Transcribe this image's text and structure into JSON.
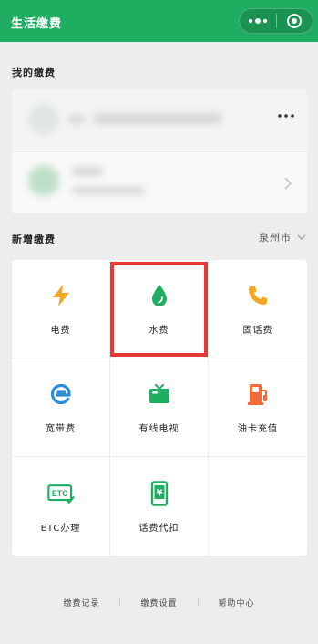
{
  "header": {
    "title": "生活缴费"
  },
  "sections": {
    "mine": "我的缴费",
    "new": "新增缴费"
  },
  "city": "泉州市",
  "services": [
    {
      "label": "电费",
      "icon": "lightning-icon",
      "color": "#f5a623"
    },
    {
      "label": "水费",
      "icon": "water-drop-icon",
      "color": "#1fae61"
    },
    {
      "label": "固话费",
      "icon": "phone-icon",
      "color": "#f5a623"
    },
    {
      "label": "宽带费",
      "icon": "broadband-e-icon",
      "color": "#2a8cdb"
    },
    {
      "label": "有线电视",
      "icon": "tv-icon",
      "color": "#1fae61"
    },
    {
      "label": "油卡充值",
      "icon": "gas-pump-icon",
      "color": "#f26b3a"
    },
    {
      "label": "ETC办理",
      "icon": "etc-icon",
      "color": "#1fae61"
    },
    {
      "label": "话费代扣",
      "icon": "mobile-yuan-icon",
      "color": "#1fae61"
    }
  ],
  "footer": {
    "records": "缴费记录",
    "settings": "缴费设置",
    "help": "帮助中心"
  }
}
